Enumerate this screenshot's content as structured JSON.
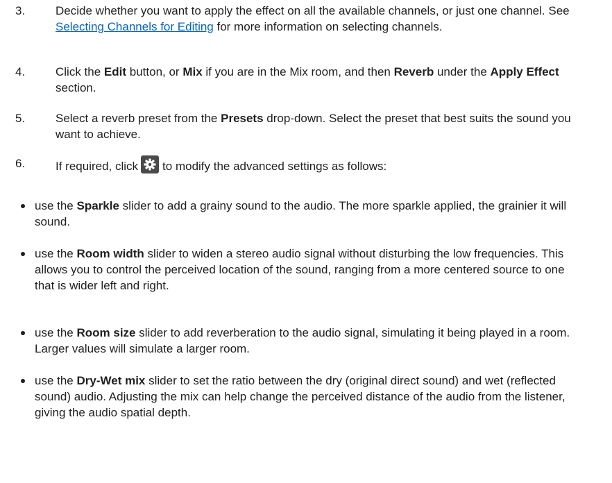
{
  "steps": [
    {
      "number": "3.",
      "text_before": "Decide whether you want to apply the effect on all the available channels, or just one channel. See ",
      "link_text": "Selecting Channels for Editing",
      "text_after": " for more information on selecting channels."
    },
    {
      "number": "4.",
      "t1": "Click the ",
      "b1": "Edit",
      "t2": " button, or ",
      "b2": "Mix",
      "t3": " if you are in the Mix room, and then ",
      "b3": "Reverb",
      "t4": " under the ",
      "b4": "Apply Effect",
      "t5": " section."
    },
    {
      "number": "5.",
      "t1": "Select a reverb preset from the ",
      "b1": "Presets",
      "t2": " drop-down. Select the preset that best suits the sound you want to achieve."
    },
    {
      "number": "6.",
      "t1": "If required, click",
      "icon": "gear-icon",
      "t2": "to modify the advanced settings as follows:"
    }
  ],
  "bullets": [
    {
      "t1": "use the ",
      "b1": "Sparkle",
      "t2": " slider to add a grainy sound to the audio. The more sparkle applied, the grainier it will sound."
    },
    {
      "t1": "use the ",
      "b1": "Room width",
      "t2": " slider to widen a stereo audio signal without disturbing the low frequencies. This allows you to control the perceived location of the sound, ranging from a more centered source to one that is wider left and right."
    },
    {
      "t1": "use the ",
      "b1": "Room size",
      "t2": " slider to add reverberation to the audio signal, simulating it being played in a room. Larger values will simulate a larger room."
    },
    {
      "t1": "use the ",
      "b1": "Dry-Wet mix",
      "t2": " slider to set the ratio between the dry (original direct sound) and wet (reflected sound) audio. Adjusting the mix can help change the perceived distance of the audio from the listener, giving the audio spatial depth."
    }
  ],
  "colors": {
    "text": "#1f1f1f",
    "link": "#0563c1",
    "icon_bg": "#4a4a4a"
  }
}
